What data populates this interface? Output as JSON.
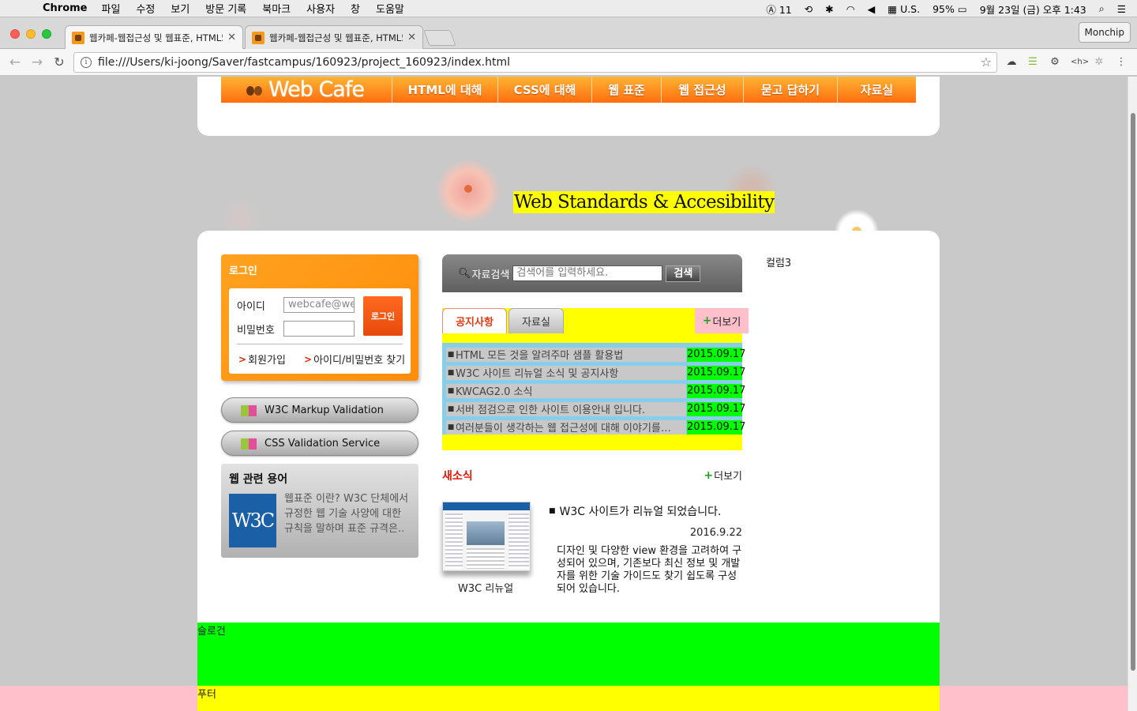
{
  "menubar": {
    "app_name": "Chrome",
    "items": [
      "파일",
      "수정",
      "보기",
      "방문 기록",
      "북마크",
      "사용자",
      "창",
      "도움말"
    ],
    "status": {
      "notif": "11",
      "input_source": "U.S.",
      "battery": "95%",
      "datetime": "9월 23일 (금) 오후 1:43"
    }
  },
  "browser": {
    "tabs": [
      {
        "title": "웹카페-웹접근성 및 웹표준, HTML5"
      },
      {
        "title": "웹카페-웹접근성 및 웹표준, HTML5"
      }
    ],
    "profile": "Monchip",
    "url": "file:///Users/ki-joong/Saver/fastcampus/160923/project_160923/index.html"
  },
  "header": {
    "logo": "Web Cafe",
    "menu": [
      "HTML에 대해",
      "CSS에 대해",
      "웹 표준",
      "웹 접근성",
      "묻고 답하기",
      "자료실"
    ]
  },
  "visual": {
    "tagline": "Web Standards & Accesibility"
  },
  "login": {
    "title": "로그인",
    "id_label": "아이디",
    "id_value": "webcafe@webcafe.com",
    "pw_label": "비밀번호",
    "button": "로그인",
    "join": "회원가입",
    "find": "아이디/비밀번호 찾기"
  },
  "validation": {
    "markup": "W3C Markup Validation",
    "css": "CSS Validation Service"
  },
  "glossary": {
    "title": "웹 관련 용어",
    "logo": "W3C",
    "text": "웹표준 이란? W3C 단체에서 규정한 웹 기술 사양에 대한 규칙을 말하며 표준 규격은.."
  },
  "search": {
    "label": "자료검색",
    "placeholder": "검색어를 입력하세요.",
    "button": "검색"
  },
  "notice": {
    "tab_active": "공지사항",
    "tab_inactive": "자료실",
    "more": "더보기",
    "rows": [
      {
        "title": "HTML 모든 것을 알려주마 샘플 활용법",
        "date": "2015.09.17"
      },
      {
        "title": "W3C 사이트 리뉴얼 소식 및 공지사항",
        "date": "2015.09.17"
      },
      {
        "title": "KWCAG2.0 소식",
        "date": "2015.09.17"
      },
      {
        "title": "서버 점검으로 인한 사이트 이용안내 입니다.",
        "date": "2015.09.17"
      },
      {
        "title": "여러분들이 생각하는 웹 접근성에 대해 이야기를…",
        "date": "2015.09.17"
      }
    ]
  },
  "news": {
    "title": "새소식",
    "more": "더보기",
    "caption": "W3C 리뉴얼",
    "headline": "W3C 사이트가 리뉴얼 되었습니다.",
    "date": "2016.9.22",
    "body": "디자인 및 다양한 view 환경을 고려하여 구성되어 있으며, 기존보다 최신 정보 및 개발자를 위한 기술 가이드도 찾기 쉽도록 구성되어 있습니다."
  },
  "column3": "컬럼3",
  "slogan": "슬로건",
  "footer": "푸터"
}
